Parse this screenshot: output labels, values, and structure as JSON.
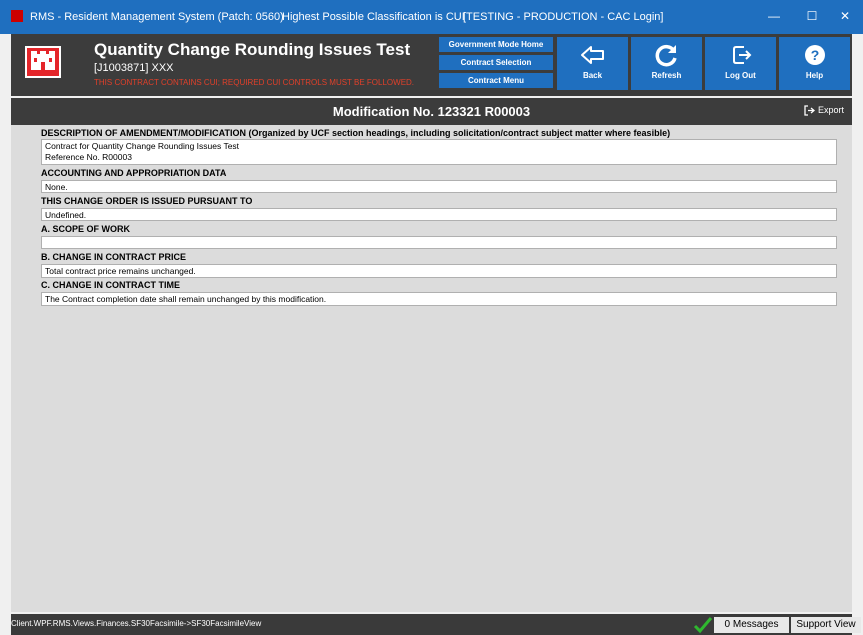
{
  "window": {
    "app_title": "RMS - Resident Management System (Patch: 0560)",
    "classification": "Highest Possible Classification is CUI",
    "environment": "[TESTING - PRODUCTION - CAC Login]",
    "minimize": "—",
    "maximize": "☐",
    "close": "✕"
  },
  "header": {
    "title": "Quantity Change Rounding Issues Test",
    "contract_id": "[J1003871] XXX",
    "warning": "THIS CONTRACT CONTAINS CUI; REQUIRED CUI CONTROLS MUST BE FOLLOWED.",
    "nav": {
      "gov_home": "Government Mode Home",
      "contract_selection": "Contract Selection",
      "contract_menu": "Contract Menu"
    },
    "buttons": {
      "back": "Back",
      "refresh": "Refresh",
      "logout": "Log Out",
      "help": "Help"
    }
  },
  "modification": {
    "title": "Modification No. 123321 R00003",
    "export": "Export"
  },
  "sections": {
    "description_heading": "DESCRIPTION OF AMENDMENT/MODIFICATION (Organized by UCF section headings, including solicitation/contract subject matter where feasible)",
    "description_lines": [
      "Contract for Quantity Change Rounding Issues Test",
      "Reference No. R00003"
    ],
    "accounting_heading": "ACCOUNTING AND APPROPRIATION DATA",
    "accounting_value": "None.",
    "pursuant_heading": "THIS CHANGE ORDER IS ISSUED PURSUANT TO",
    "pursuant_value": "Undefined.",
    "scope_heading": "A. SCOPE OF WORK",
    "scope_value": "",
    "price_heading": "B. CHANGE IN CONTRACT PRICE",
    "price_value": "Total contract price remains unchanged.",
    "time_heading": "C. CHANGE IN CONTRACT TIME",
    "time_value": "The Contract completion date shall remain unchanged by this modification."
  },
  "status": {
    "path": "Client.WPF.RMS.Views.Finances.SF30Facsimile->SF30FacsimileView",
    "messages": "0 Messages",
    "support": "Support View"
  },
  "colors": {
    "accent": "#1f6fbf",
    "header_bg": "#3c3c3c",
    "warning": "#e0402a",
    "logo_red": "#e4252a"
  }
}
